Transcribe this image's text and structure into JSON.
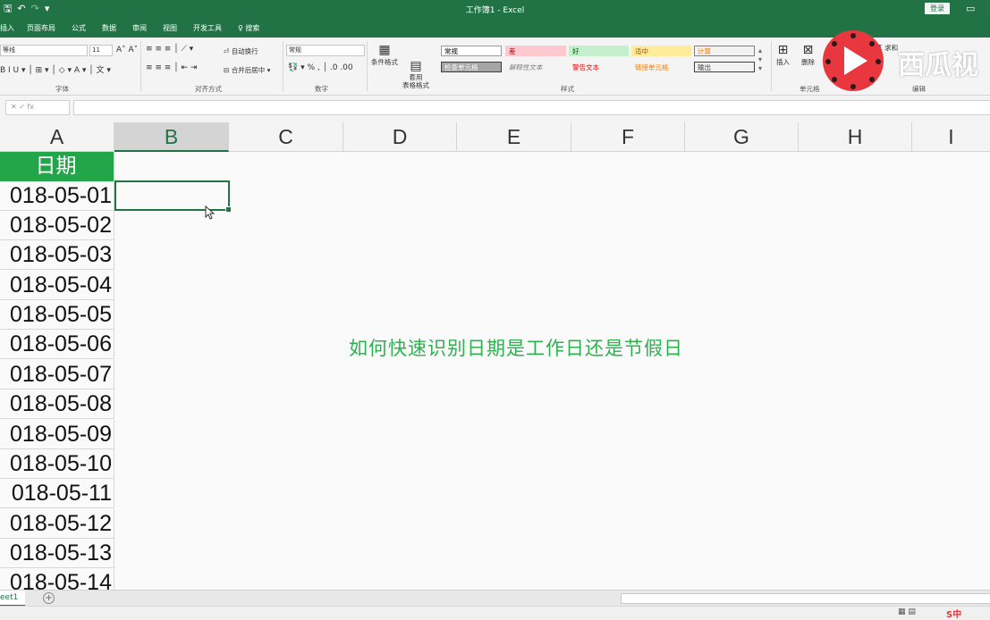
{
  "titlebar": {
    "doc_title": "工作簿1 - Excel",
    "login_label": "登录"
  },
  "tabs": [
    {
      "label": "插入"
    },
    {
      "label": "页面布局"
    },
    {
      "label": "公式"
    },
    {
      "label": "数据"
    },
    {
      "label": "审阅"
    },
    {
      "label": "视图"
    },
    {
      "label": "开发工具"
    },
    {
      "label": "搜索"
    }
  ],
  "ribbon": {
    "font_name": "等线",
    "font_size": "11",
    "wrap_text": "自动换行",
    "merge_center": "合并后居中",
    "number_format": "常规",
    "cond_format": "条件格式",
    "table_format": "套用\n表格格式",
    "insert": "插入",
    "delete": "删除",
    "sum": "求和",
    "groups": {
      "font": "字体",
      "align": "对齐方式",
      "number": "数字",
      "styles": "样式",
      "cells": "单元格",
      "edit": "编辑"
    },
    "styles": [
      {
        "label": "常规",
        "bg": "#ffffff",
        "fg": "#000000",
        "border": "#9a9a9a"
      },
      {
        "label": "差",
        "bg": "#ffc7ce",
        "fg": "#9c0006",
        "border": "#ffc7ce"
      },
      {
        "label": "好",
        "bg": "#c6efce",
        "fg": "#006100",
        "border": "#c6efce"
      },
      {
        "label": "适中",
        "bg": "#ffeb9c",
        "fg": "#9c5700",
        "border": "#ffeb9c"
      },
      {
        "label": "计算",
        "bg": "#f2f2f2",
        "fg": "#fa7d00",
        "border": "#7f7f7f"
      },
      {
        "label": "检查单元格",
        "bg": "#a5a5a5",
        "fg": "#ffffff",
        "border": "#3f3f3f"
      },
      {
        "label": "解释性文本",
        "bg": "#f4f4f4",
        "fg": "#7f7f7f",
        "border": "#f4f4f4"
      },
      {
        "label": "警告文本",
        "bg": "#f4f4f4",
        "fg": "#ff0000",
        "border": "#f4f4f4"
      },
      {
        "label": "链接单元格",
        "bg": "#f4f4f4",
        "fg": "#fa7d00",
        "border": "#f4f4f4"
      },
      {
        "label": "输出",
        "bg": "#f2f2f2",
        "fg": "#3f3f3f",
        "border": "#3f3f3f"
      }
    ]
  },
  "formula_bar": {
    "name_box_icons": "✕ ✓ fx",
    "value": ""
  },
  "columns": [
    "A",
    "B",
    "C",
    "D",
    "E",
    "F",
    "G",
    "H",
    "I"
  ],
  "header_cell": "日期",
  "dates": [
    "018-05-01",
    "018-05-02",
    "018-05-03",
    "018-05-04",
    "018-05-05",
    "018-05-06",
    "018-05-07",
    "018-05-08",
    "018-05-09",
    "018-05-10",
    "018-05-11",
    "018-05-12",
    "018-05-13",
    "018-05-14"
  ],
  "overlay_caption": "如何快速识别日期是工作日还是节假日",
  "sheet_tab": "eet1",
  "watermark": {
    "text": "西瓜视",
    "colors": {
      "logo": "#e8373e"
    }
  },
  "accent": "#217346"
}
